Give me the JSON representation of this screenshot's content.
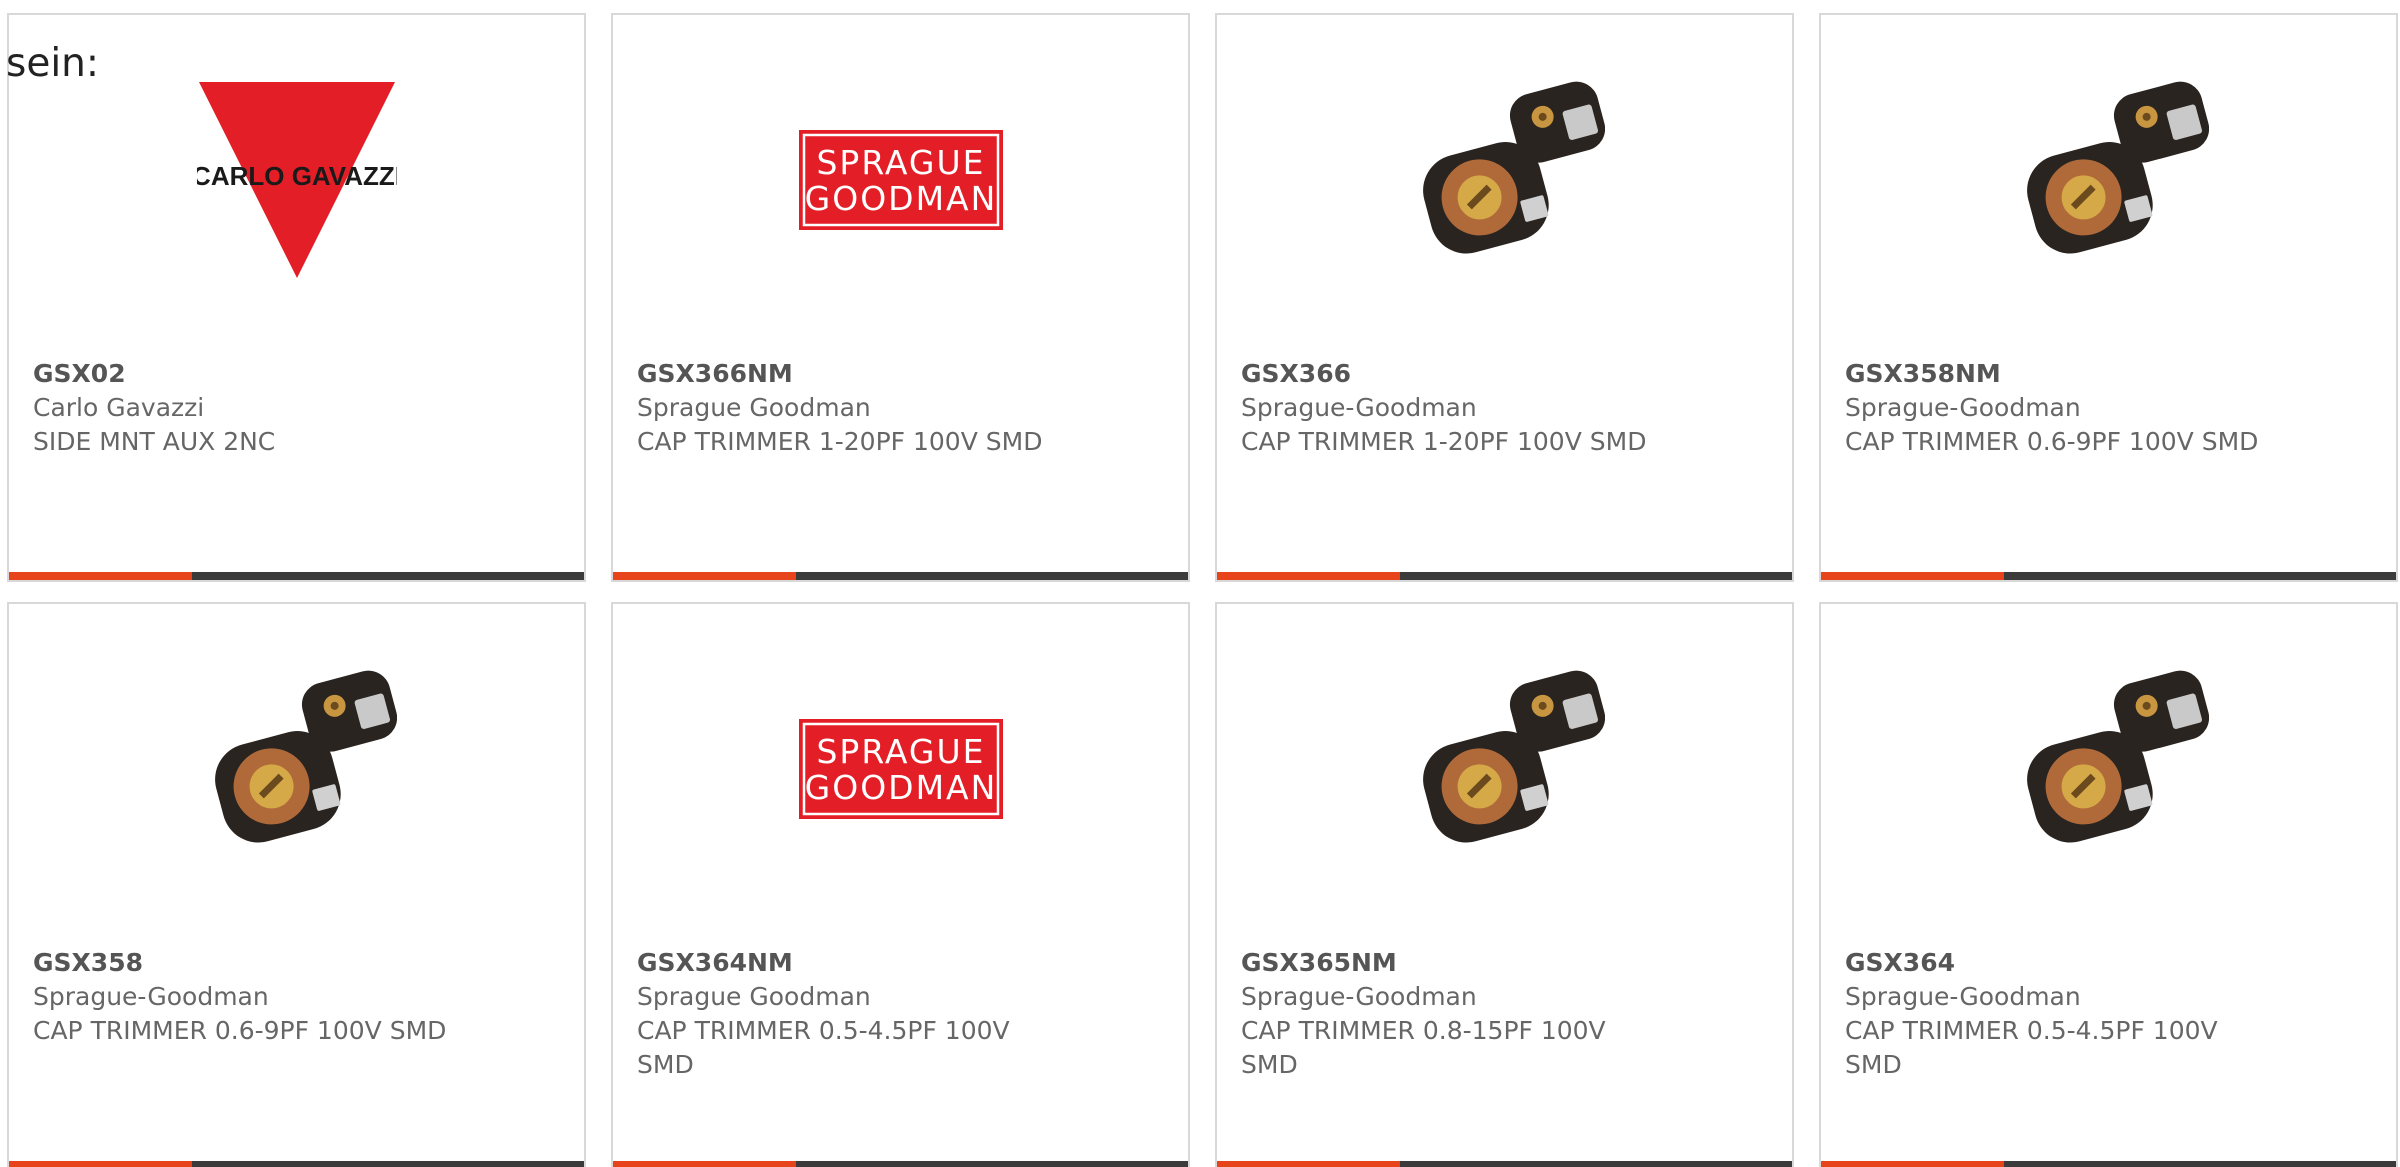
{
  "intro_text": "sein:",
  "colors": {
    "accent": "#e8441c",
    "bar": "#3b3b3b",
    "brand_red": "#e41e26"
  },
  "cards": [
    {
      "part": "GSX02",
      "maker": "Carlo Gavazzi",
      "desc": "SIDE MNT AUX 2NC",
      "image": "carlo-gavazzi-logo",
      "logo_text": "CARLO GAVAZZI"
    },
    {
      "part": "GSX366NM",
      "maker": "Sprague Goodman",
      "desc": "CAP TRIMMER 1-20PF 100V SMD",
      "image": "sprague-goodman-logo",
      "logo_line1": "SPRAGUE",
      "logo_line2": "GOODMAN"
    },
    {
      "part": "GSX366",
      "maker": "Sprague-Goodman",
      "desc": "CAP TRIMMER 1-20PF 100V SMD",
      "image": "trimmer-capacitor-photo"
    },
    {
      "part": "GSX358NM",
      "maker": "Sprague-Goodman",
      "desc": "CAP TRIMMER 0.6-9PF 100V SMD",
      "image": "trimmer-capacitor-photo"
    },
    {
      "part": "GSX358",
      "maker": "Sprague-Goodman",
      "desc": "CAP TRIMMER 0.6-9PF 100V SMD",
      "image": "trimmer-capacitor-photo"
    },
    {
      "part": "GSX364NM",
      "maker": "Sprague Goodman",
      "desc": "CAP TRIMMER 0.5-4.5PF 100V SMD",
      "image": "sprague-goodman-logo",
      "logo_line1": "SPRAGUE",
      "logo_line2": "GOODMAN"
    },
    {
      "part": "GSX365NM",
      "maker": "Sprague-Goodman",
      "desc": "CAP TRIMMER 0.8-15PF 100V SMD",
      "image": "trimmer-capacitor-photo"
    },
    {
      "part": "GSX364",
      "maker": "Sprague-Goodman",
      "desc": "CAP TRIMMER 0.5-4.5PF 100V SMD",
      "image": "trimmer-capacitor-photo"
    }
  ]
}
